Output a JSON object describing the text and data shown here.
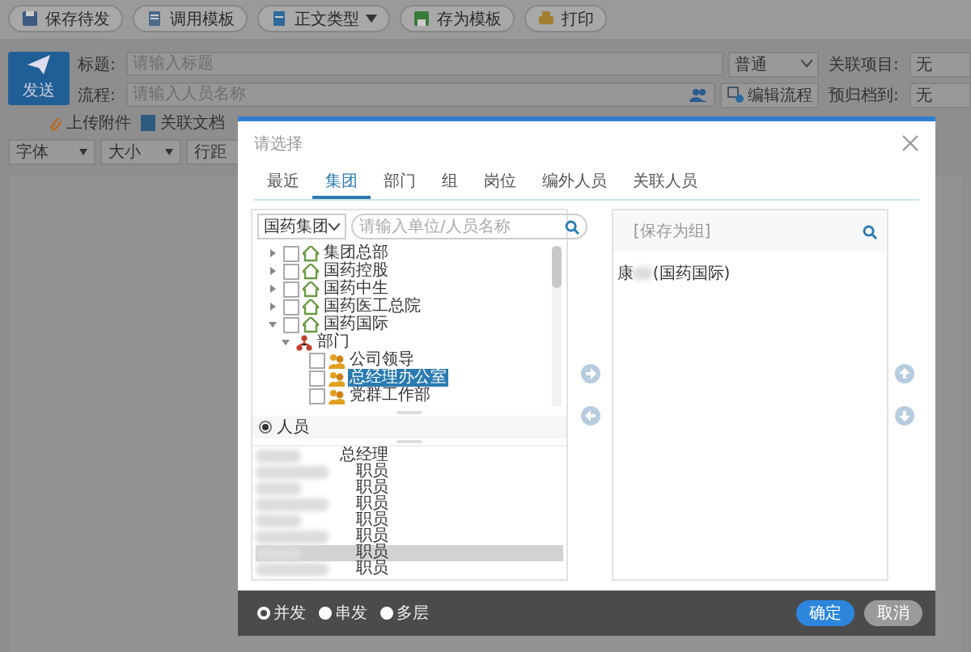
{
  "toolbar": [
    {
      "label": "保存待发",
      "dropdown": false
    },
    {
      "label": "调用模板",
      "dropdown": false
    },
    {
      "label": "正文类型",
      "dropdown": true
    },
    {
      "label": "存为模板",
      "dropdown": false
    },
    {
      "label": "打印",
      "dropdown": false
    }
  ],
  "send_button": "发送",
  "form": {
    "title_label": "标题:",
    "title_placeholder": "请输入标题",
    "priority": "普通",
    "project_label": "关联项目:",
    "project_value": "无",
    "flow_label": "流程:",
    "flow_placeholder": "请输入人员名称",
    "edit_flow": "编辑流程",
    "archive_label": "预归档到:",
    "archive_value": "无"
  },
  "attachments": [
    "上传附件",
    "关联文档"
  ],
  "format_selects": [
    "字体",
    "大小",
    "行距"
  ],
  "dialog": {
    "title": "请选择",
    "tabs": [
      {
        "label": "最近",
        "selected": false
      },
      {
        "label": "集团",
        "selected": true
      },
      {
        "label": "部门",
        "selected": false
      },
      {
        "label": "组",
        "selected": false
      },
      {
        "label": "岗位",
        "selected": false
      },
      {
        "label": "编外人员",
        "selected": false
      },
      {
        "label": "关联人员",
        "selected": false
      }
    ],
    "scope": "国药集团",
    "search_placeholder": "请输入单位/人员名称",
    "tree": [
      {
        "label": "集团总部",
        "kind": "org",
        "expanded": false,
        "checked": false
      },
      {
        "label": "国药控股",
        "kind": "org",
        "expanded": false,
        "checked": false
      },
      {
        "label": "国药中生",
        "kind": "org",
        "expanded": false,
        "checked": false
      },
      {
        "label": "国药医工总院",
        "kind": "org",
        "expanded": false,
        "checked": false
      },
      {
        "label": "国药国际",
        "kind": "org",
        "expanded": true,
        "checked": false,
        "children": [
          {
            "label": "部门",
            "kind": "dept",
            "expanded": true,
            "children": [
              {
                "label": "公司领导",
                "kind": "office",
                "checked": false,
                "selected": false
              },
              {
                "label": "总经理办公室",
                "kind": "office",
                "checked": false,
                "selected": true
              },
              {
                "label": "党群工作部",
                "kind": "office",
                "checked": false,
                "selected": false
              }
            ]
          }
        ]
      }
    ],
    "people_label": "人员",
    "people": [
      {
        "role": "总经理",
        "selected": false
      },
      {
        "role": "职员",
        "selected": false
      },
      {
        "role": "职员",
        "selected": false
      },
      {
        "role": "职员",
        "selected": false
      },
      {
        "role": "职员",
        "selected": false
      },
      {
        "role": "职员",
        "selected": false
      },
      {
        "role": "职员",
        "selected": true
      },
      {
        "role": "职员",
        "selected": false
      }
    ],
    "save_group": "[保存为组]",
    "chosen": [
      {
        "name_start": "康",
        "org": "(国药国际)"
      }
    ],
    "modes": [
      {
        "label": "并发",
        "selected": true
      },
      {
        "label": "串发",
        "selected": false
      },
      {
        "label": "多层",
        "selected": false
      }
    ],
    "ok": "确定",
    "cancel": "取消"
  }
}
